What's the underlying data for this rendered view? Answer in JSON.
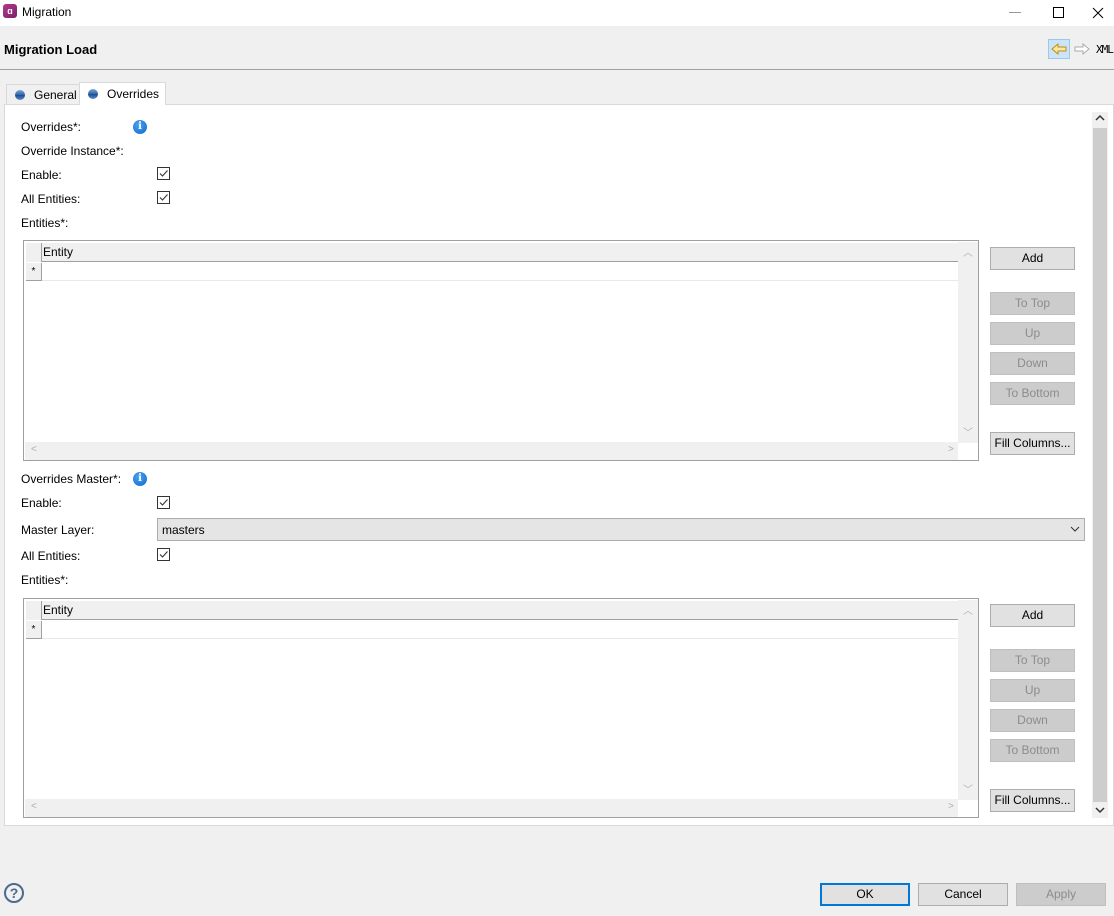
{
  "window": {
    "title": "Migration",
    "app_icon": "app-logo-icon",
    "controls": {
      "minimize": "—",
      "maximize": "☐",
      "close": "✕"
    }
  },
  "header": {
    "title": "Migration Load",
    "back_icon": "arrow-left-icon",
    "forward_icon": "arrow-right-icon",
    "xml_label": "XML"
  },
  "tabs": [
    {
      "label": "General",
      "active": false
    },
    {
      "label": "Overrides",
      "active": true
    }
  ],
  "overrides": {
    "label": "Overrides*:",
    "instance": {
      "label": "Override Instance*:",
      "enable_label": "Enable:",
      "enable_checked": true,
      "all_entities_label": "All Entities:",
      "all_entities_checked": true,
      "entities_label": "Entities*:",
      "table": {
        "columns": [
          "Entity"
        ],
        "new_row_marker": "*"
      },
      "buttons": {
        "add": "Add",
        "to_top": "To Top",
        "up": "Up",
        "down": "Down",
        "to_bottom": "To Bottom",
        "fill_columns": "Fill Columns..."
      }
    },
    "master": {
      "label": "Overrides Master*:",
      "enable_label": "Enable:",
      "enable_checked": true,
      "master_layer_label": "Master Layer:",
      "master_layer_value": "masters",
      "all_entities_label": "All Entities:",
      "all_entities_checked": true,
      "entities_label": "Entities*:",
      "table": {
        "columns": [
          "Entity"
        ],
        "new_row_marker": "*"
      },
      "buttons": {
        "add": "Add",
        "to_top": "To Top",
        "up": "Up",
        "down": "Down",
        "to_bottom": "To Bottom",
        "fill_columns": "Fill Columns..."
      }
    }
  },
  "footer": {
    "help_icon": "?",
    "ok": "OK",
    "cancel": "Cancel",
    "apply": "Apply"
  },
  "icons": {
    "check": "✓",
    "chevron_down": "⌄",
    "scroll_up": "^",
    "scroll_down": "v",
    "scroll_left": "<",
    "scroll_right": ">"
  }
}
